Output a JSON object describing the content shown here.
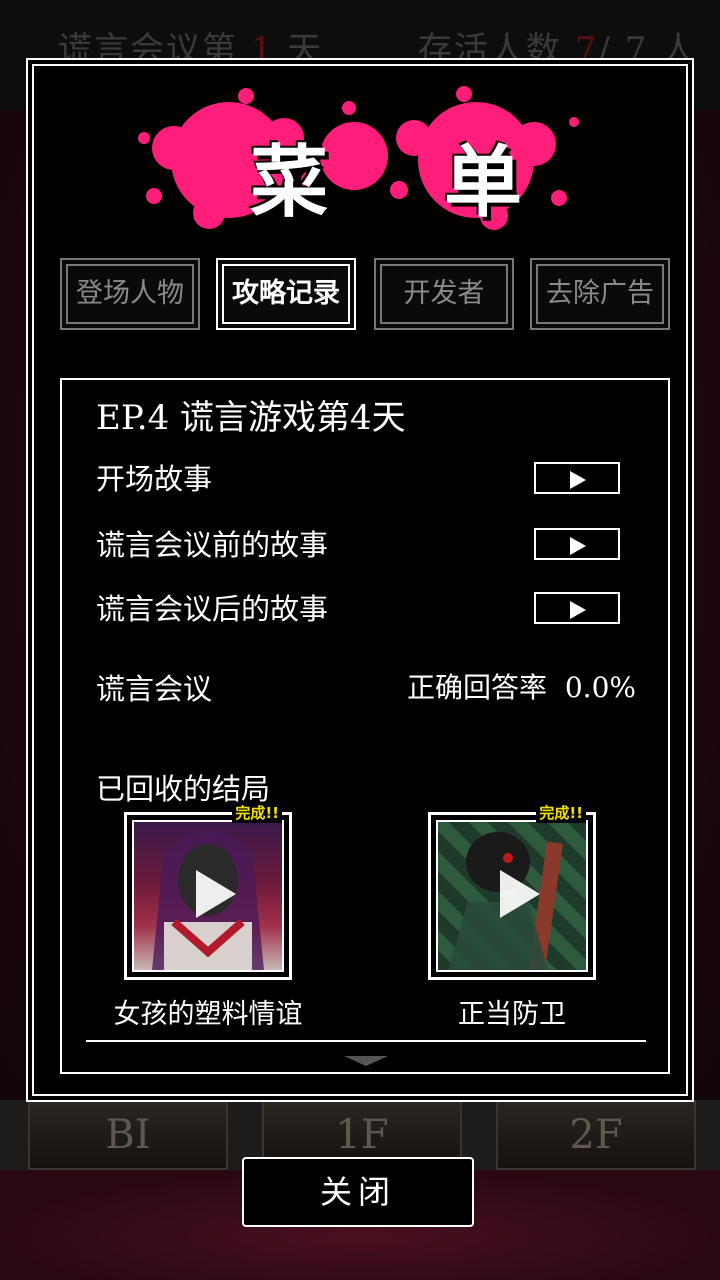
{
  "hud": {
    "day_label": "谎言会议第",
    "day_value": "1",
    "day_unit": "天",
    "alive_label": "存活人数",
    "alive_value": "7",
    "alive_sep": "/",
    "alive_total": "7",
    "alive_unit": "人"
  },
  "floors": [
    "BI",
    "1F",
    "2F"
  ],
  "menu": {
    "title_chars": [
      "菜",
      "单"
    ],
    "tabs": [
      {
        "label": "登场人物",
        "active": false
      },
      {
        "label": "攻略记录",
        "active": true
      },
      {
        "label": "开发者",
        "active": false
      },
      {
        "label": "去除广告",
        "active": false
      }
    ]
  },
  "episode": {
    "title": "EP.4  谎言游戏第4天",
    "stories": [
      {
        "label": "开场故事"
      },
      {
        "label": "谎言会议前的故事"
      },
      {
        "label": "谎言会议后的故事"
      }
    ],
    "meeting_label": "谎言会议",
    "rate_label": "正确回答率",
    "rate_value": "0.0%",
    "endings_label": "已回收的结局",
    "endings": [
      {
        "name": "女孩的塑料情谊",
        "badge": "完成!!"
      },
      {
        "name": "正当防卫",
        "badge": "完成!!"
      }
    ]
  },
  "close_label": "关闭",
  "colors": {
    "accent_pink": "#ff1f7a",
    "badge_yellow": "#f0e000"
  }
}
